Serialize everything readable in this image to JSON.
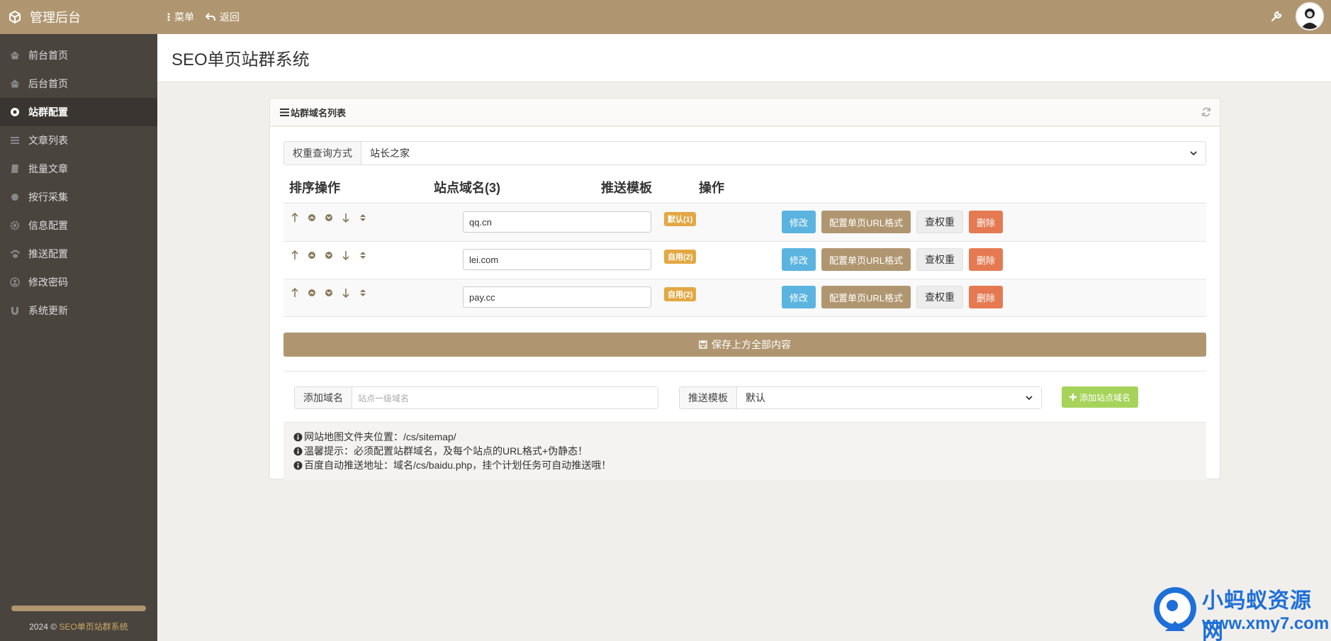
{
  "topbar": {
    "brand": "管理后台",
    "menu_label": "菜单",
    "back_label": "返回"
  },
  "sidebar": {
    "items": [
      {
        "label": "前台首页",
        "icon": "home-icon"
      },
      {
        "label": "后台首页",
        "icon": "home-icon"
      },
      {
        "label": "站群配置",
        "icon": "chrome-icon",
        "active": true
      },
      {
        "label": "文章列表",
        "icon": "list-icon"
      },
      {
        "label": "批量文章",
        "icon": "book-icon"
      },
      {
        "label": "按行采集",
        "icon": "circle-icon"
      },
      {
        "label": "信息配置",
        "icon": "gear-icon"
      },
      {
        "label": "推送配置",
        "icon": "paw-icon"
      },
      {
        "label": "修改密码",
        "icon": "user-circle-icon"
      },
      {
        "label": "系统更新",
        "icon": "magnet-icon"
      }
    ],
    "copyright_prefix": "2024 © ",
    "copyright_link": "SEO单页站群系统"
  },
  "page": {
    "title": "SEO单页站群系统"
  },
  "panel": {
    "title": "站群域名列表",
    "weight_addon": "权重查询方式",
    "weight_selected": "站长之家",
    "columns": {
      "sort": "排序操作",
      "domain": "站点域名(3)",
      "template": "推送模板",
      "ops": "操作"
    },
    "rows": [
      {
        "domain": "qq.cn",
        "badge": "默认(1)"
      },
      {
        "domain": "lei.com",
        "badge": "自用(2)"
      },
      {
        "domain": "pay.cc",
        "badge": "自用(2)"
      }
    ],
    "buttons": {
      "edit": "修改",
      "config_url": "配置单页URL格式",
      "check_weight": "查权重",
      "delete": "删除"
    },
    "save_label": "保存上方全部内容",
    "add_domain_addon": "添加域名",
    "add_domain_placeholder": "站点一级域名",
    "push_template_addon": "推送模板",
    "push_template_selected": "默认",
    "add_site_button": "添加站点域名",
    "notices": [
      "网站地图文件夹位置：/cs/sitemap/",
      "温馨提示：必须配置站群域名，及每个站点的URL格式+伪静态！",
      "百度自动推送地址：域名/cs/baidu.php，挂个计划任务可自动推送哦！"
    ]
  },
  "watermark": {
    "line1": "小蚂蚁资源网",
    "line2": "www.xmy7.com"
  },
  "colors": {
    "accent": "#b09670",
    "sidebar": "#4a443e",
    "info": "#5bb4e0",
    "danger": "#e57a52",
    "badge": "#e3a844",
    "success": "#a6d35a"
  }
}
